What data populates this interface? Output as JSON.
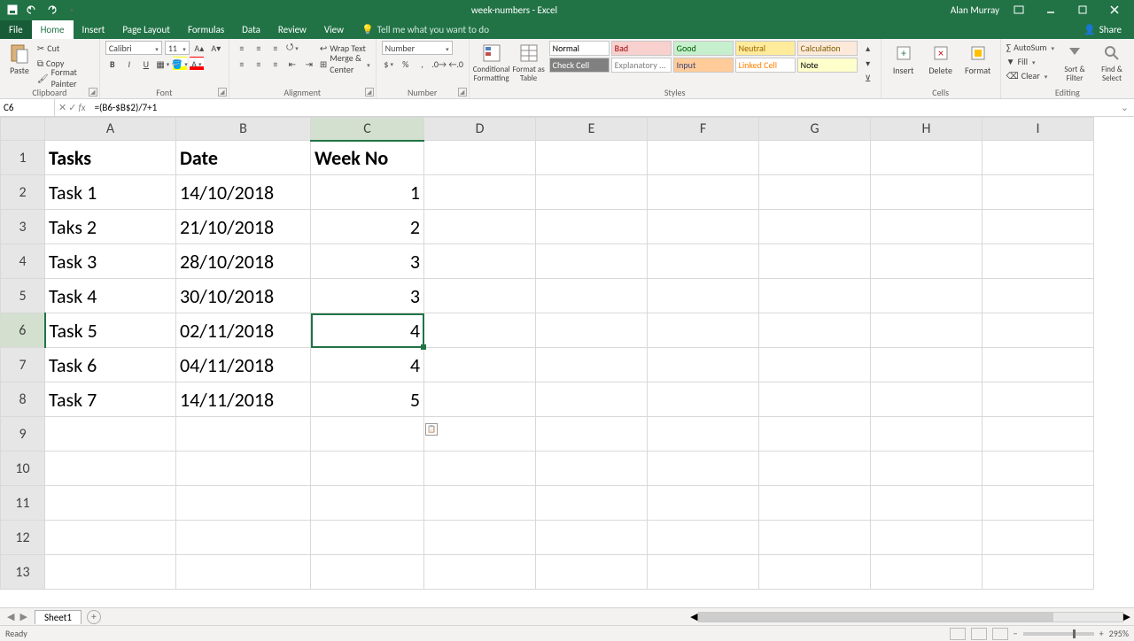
{
  "app": {
    "title": "week-numbers - Excel",
    "user": "Alan Murray"
  },
  "qat": {
    "save": "Save",
    "undo": "Undo",
    "redo": "Redo"
  },
  "tabs": [
    "File",
    "Home",
    "Insert",
    "Page Layout",
    "Formulas",
    "Data",
    "Review",
    "View"
  ],
  "activeTab": "Home",
  "tellme": "Tell me what you want to do",
  "share": "Share",
  "ribbon": {
    "clipboard": {
      "name": "Clipboard",
      "paste": "Paste",
      "cut": "Cut",
      "copy": "Copy",
      "painter": "Format Painter"
    },
    "font": {
      "name": "Font",
      "family": "Calibri",
      "size": "11"
    },
    "alignment": {
      "name": "Alignment",
      "wrap": "Wrap Text",
      "merge": "Merge & Center"
    },
    "number": {
      "name": "Number",
      "format": "Number"
    },
    "styles": {
      "name": "Styles",
      "cond": "Conditional Formatting",
      "table": "Format as Table",
      "row1": [
        {
          "label": "Normal",
          "bg": "#ffffff",
          "fg": "#000"
        },
        {
          "label": "Bad",
          "bg": "#f8d0cd",
          "fg": "#9c0006"
        },
        {
          "label": "Good",
          "bg": "#c6efce",
          "fg": "#006100"
        },
        {
          "label": "Neutral",
          "bg": "#ffeb9c",
          "fg": "#9c6500"
        },
        {
          "label": "Calculation",
          "bg": "#fde9d9",
          "fg": "#7f6000"
        }
      ],
      "row2": [
        {
          "label": "Check Cell",
          "bg": "#808080",
          "fg": "#ffffff"
        },
        {
          "label": "Explanatory ...",
          "bg": "#ffffff",
          "fg": "#7f7f7f"
        },
        {
          "label": "Input",
          "bg": "#ffcc99",
          "fg": "#3f3f76"
        },
        {
          "label": "Linked Cell",
          "bg": "#ffffff",
          "fg": "#ff8001"
        },
        {
          "label": "Note",
          "bg": "#ffffcc",
          "fg": "#000"
        }
      ]
    },
    "cells": {
      "name": "Cells",
      "insert": "Insert",
      "delete": "Delete",
      "format": "Format"
    },
    "editing": {
      "name": "Editing",
      "autosum": "AutoSum",
      "fill": "Fill",
      "clear": "Clear",
      "sort": "Sort & Filter",
      "find": "Find & Select"
    }
  },
  "fbar": {
    "cell": "C6",
    "formula": "=(B6-$B$2)/7+1"
  },
  "columns": [
    "A",
    "B",
    "C",
    "D",
    "E",
    "F",
    "G",
    "H",
    "I"
  ],
  "gridHeaders": {
    "a": "Tasks",
    "b": "Date",
    "c": "Week No"
  },
  "gridData": [
    {
      "a": "Task 1",
      "b": "14/10/2018",
      "c": "1"
    },
    {
      "a": "Taks 2",
      "b": "21/10/2018",
      "c": "2"
    },
    {
      "a": "Task 3",
      "b": "28/10/2018",
      "c": "3"
    },
    {
      "a": "Task 4",
      "b": "30/10/2018",
      "c": "3"
    },
    {
      "a": "Task 5",
      "b": "02/11/2018",
      "c": "4"
    },
    {
      "a": "Task 6",
      "b": "04/11/2018",
      "c": "4"
    },
    {
      "a": "Task 7",
      "b": "14/11/2018",
      "c": "5"
    }
  ],
  "selected": {
    "row": 6,
    "col": "C"
  },
  "sheet": {
    "active": "Sheet1"
  },
  "status": {
    "ready": "Ready",
    "zoom": "295%"
  }
}
